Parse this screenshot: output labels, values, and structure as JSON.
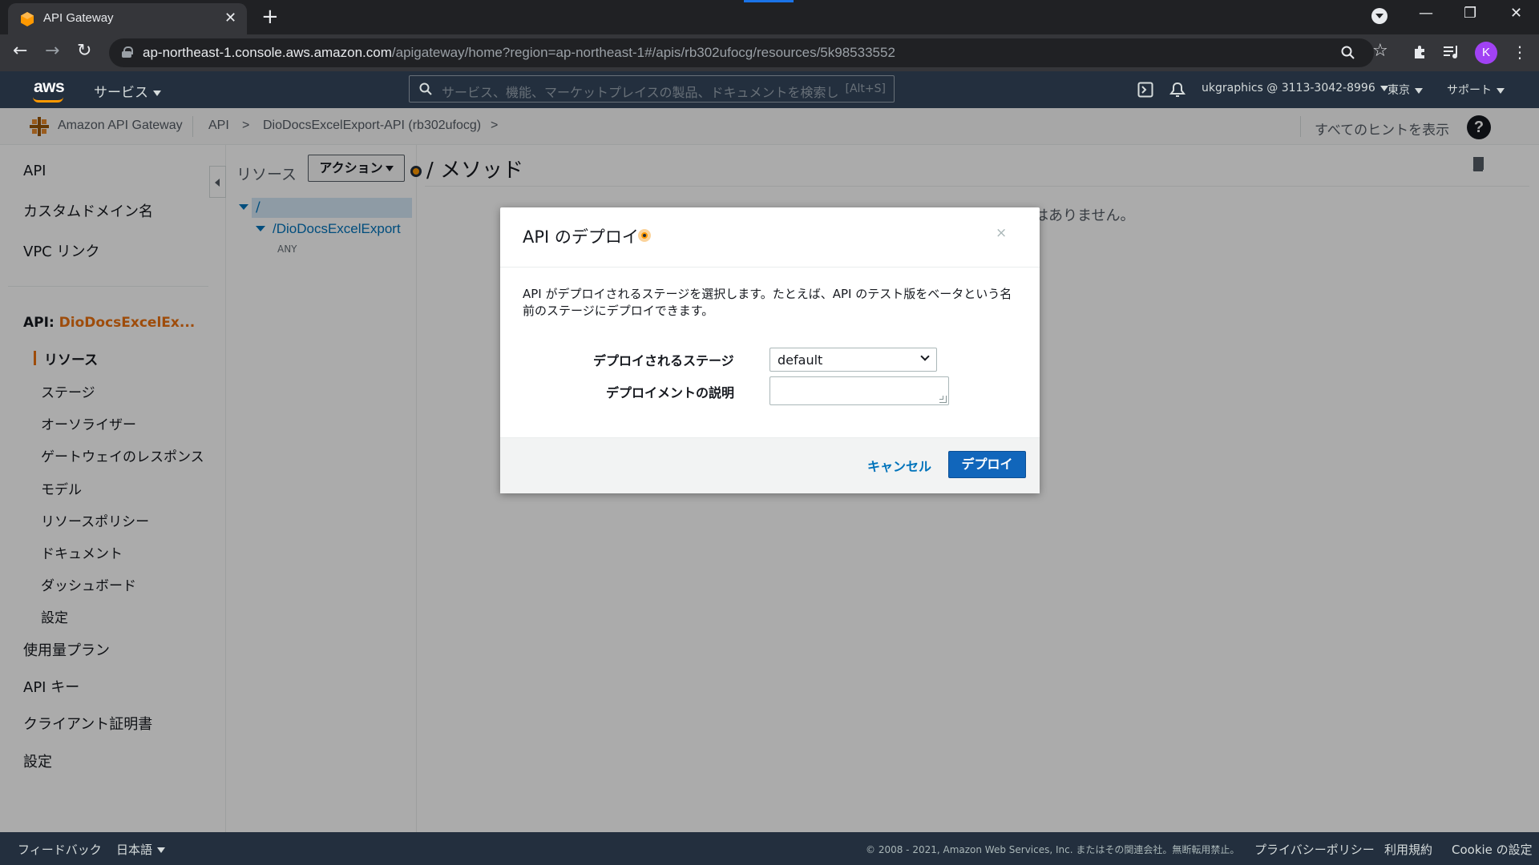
{
  "browser": {
    "tab_title": "API Gateway",
    "url_host": "ap-northeast-1.console.aws.amazon.com",
    "url_path": "/apigateway/home?region=ap-northeast-1#/apis/rb302ufocg/resources/5k98533552",
    "profile_initial": "K"
  },
  "aws_nav": {
    "logo": "aws",
    "services_label": "サービス",
    "search_placeholder": "サービス、機能、マーケットプレイスの製品、ドキュメントを検索し",
    "search_shortcut": "[Alt+S]",
    "account": "ukgraphics @ 3113-3042-8996",
    "region": "東京",
    "support": "サポート"
  },
  "service_header": {
    "service_name": "Amazon API Gateway",
    "crumb_api": "API",
    "crumb_sep": ">",
    "crumb_api_name": "DioDocsExcelExport-API (rb302ufocg)",
    "crumb_sep2": ">",
    "hints_label": "すべてのヒントを表示",
    "help_symbol": "?"
  },
  "left_nav": {
    "api": "API",
    "custom_domain": "カスタムドメイン名",
    "vpc_link": "VPC リンク",
    "api_prefix": "API:",
    "api_name": "DioDocsExcelEx...",
    "sub_items": [
      "リソース",
      "ステージ",
      "オーソライザー",
      "ゲートウェイのレスポンス",
      "モデル",
      "リソースポリシー",
      "ドキュメント",
      "ダッシュボード",
      "設定"
    ],
    "usage_plan": "使用量プラン",
    "api_key": "API キー",
    "client_cert": "クライアント証明書",
    "settings": "設定"
  },
  "resources": {
    "title": "リソース",
    "actions_label": "アクション",
    "root": "/",
    "child": "/DioDocsExcelExport",
    "method": "ANY"
  },
  "content": {
    "title": "/ メソッド",
    "empty_text": "はありません。"
  },
  "modal": {
    "title": "API のデプロイ",
    "close": "×",
    "description": "API がデプロイされるステージを選択します。たとえば、API のテスト版をベータという名前のステージにデプロイできます。",
    "stage_label": "デプロイされるステージ",
    "stage_value": "default",
    "description_label": "デプロイメントの説明",
    "description_value": "",
    "cancel_label": "キャンセル",
    "deploy_label": "デプロイ"
  },
  "footer": {
    "feedback": "フィードバック",
    "language": "日本語",
    "copyright": "© 2008 - 2021, Amazon Web Services, Inc. またはその関連会社。無断転用禁止。",
    "privacy": "プライバシーポリシー",
    "terms": "利用規約",
    "cookie": "Cookie の設定"
  },
  "colors": {
    "aws_nav": "#232f3e",
    "accent_orange": "#ec7211",
    "link_blue": "#0073bb",
    "primary_button": "#1166bb"
  }
}
